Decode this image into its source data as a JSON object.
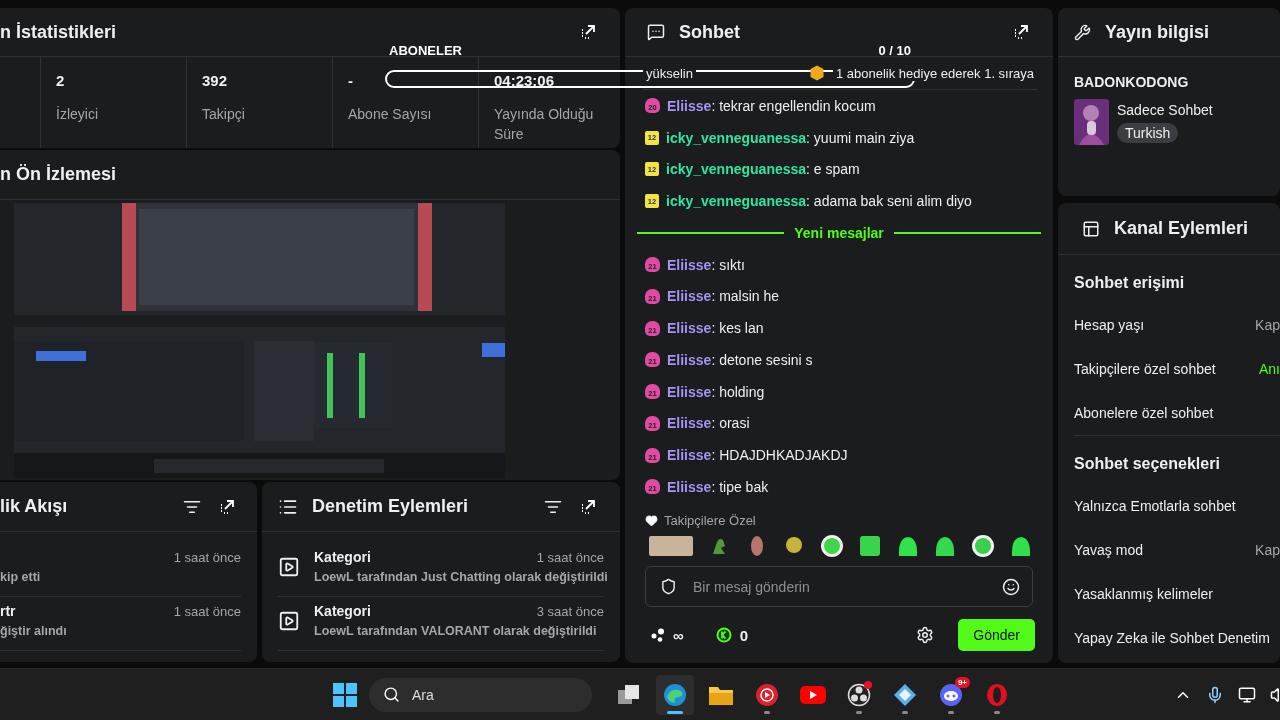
{
  "overlay": {
    "title": "ABONELER",
    "count": "0 / 10",
    "level": 0
  },
  "stats_panel": {
    "title": "n İstatistikleri",
    "stats": [
      {
        "value": "2",
        "label": "İzleyici"
      },
      {
        "value": "392",
        "label": "Takipçi"
      },
      {
        "value": "-",
        "label": "Abone Sayısı"
      },
      {
        "value": "04:23:06",
        "label": "Yayında Olduğu Süre"
      }
    ]
  },
  "preview_panel": {
    "title": "n Ön İzlemesi"
  },
  "activity_panel": {
    "title": "lik Akışı",
    "items": [
      {
        "time": "1 saat önce",
        "text": "kip etti"
      },
      {
        "title": "rtr",
        "time": "1 saat önce",
        "text": "**ğiştir** alındı"
      }
    ]
  },
  "moderation_panel": {
    "title": "Denetim Eylemleri",
    "items": [
      {
        "title": "Kategori",
        "time": "1 saat önce",
        "text": "**LoewL** tarafından **Just Chatting** olarak değiştirildi"
      },
      {
        "title": "Kategori",
        "time": "3 saat önce",
        "text": "**LoewL** tarafından **VALORANT** olarak değiştirildi"
      }
    ]
  },
  "chat": {
    "title": "Sohbet",
    "pinned": {
      "left": "yükselin",
      "text": "1 abonelik hediye ederek 1. sıraya"
    },
    "messages": [
      {
        "kind": "message",
        "badge": {
          "kind": "sub",
          "text": "20"
        },
        "user": "Eliisse",
        "color": "#a792f5",
        "text": ": tekrar engellendin kocum"
      },
      {
        "kind": "message",
        "badge": {
          "kind": "gift",
          "text": "12"
        },
        "user": "icky_venneguanessa",
        "color": "#33e6a0",
        "text": ": yuumi main ziya"
      },
      {
        "kind": "message",
        "badge": {
          "kind": "gift",
          "text": "12"
        },
        "user": "icky_venneguanessa",
        "color": "#33e6a0",
        "text": ": e spam"
      },
      {
        "kind": "message",
        "badge": {
          "kind": "gift",
          "text": "12"
        },
        "user": "icky_venneguanessa",
        "color": "#33e6a0",
        "text": ": adama bak seni alim diyo"
      },
      {
        "kind": "divider",
        "text": "Yeni mesajlar"
      },
      {
        "kind": "message",
        "badge": {
          "kind": "sub",
          "text": "21"
        },
        "user": "Eliisse",
        "color": "#a792f5",
        "text": ": sıktı"
      },
      {
        "kind": "message",
        "badge": {
          "kind": "sub",
          "text": "21"
        },
        "user": "Eliisse",
        "color": "#a792f5",
        "text": ": malsin he"
      },
      {
        "kind": "message",
        "badge": {
          "kind": "sub",
          "text": "21"
        },
        "user": "Eliisse",
        "color": "#a792f5",
        "text": ": kes lan"
      },
      {
        "kind": "message",
        "badge": {
          "kind": "sub",
          "text": "21"
        },
        "user": "Eliisse",
        "color": "#a792f5",
        "text": ": detone sesini s"
      },
      {
        "kind": "message",
        "badge": {
          "kind": "sub",
          "text": "21"
        },
        "user": "Eliisse",
        "color": "#a792f5",
        "text": ": holding"
      },
      {
        "kind": "message",
        "badge": {
          "kind": "sub",
          "text": "21"
        },
        "user": "Eliisse",
        "color": "#a792f5",
        "text": ": orasi"
      },
      {
        "kind": "message",
        "badge": {
          "kind": "sub",
          "text": "21"
        },
        "user": "Eliisse",
        "color": "#a792f5",
        "text": ": HDAJDHKADJAKDJ"
      },
      {
        "kind": "message",
        "badge": {
          "kind": "sub",
          "text": "21"
        },
        "user": "Eliisse",
        "color": "#a792f5",
        "text": ": tipe bak"
      }
    ],
    "emote_section": "Takipçilere Özel",
    "input": {
      "placeholder": "Bir mesaj gönderin"
    },
    "points": "∞",
    "coins": "0",
    "send": "Gönder"
  },
  "stream_info": {
    "title": "Yayın bilgisi",
    "stream_title": "BADONKODONG",
    "category": "Sadece Sohbet",
    "tag": "Turkish"
  },
  "channel_actions": {
    "title": "Kanal Eylemleri",
    "sections": [
      {
        "title": "Sohbet erişimi",
        "items": [
          {
            "label": "Hesap yaşı",
            "value": "Kap",
            "on": false
          },
          {
            "label": "Takipçilere özel sohbet",
            "value": "Anı",
            "on": true
          },
          {
            "label": "Abonelere özel sohbet"
          }
        ]
      },
      {
        "title": "Sohbet seçenekleri",
        "items": [
          {
            "label": "Yalnızca Emotlarla sohbet"
          },
          {
            "label": "Yavaş mod",
            "value": "Kap",
            "on": false
          },
          {
            "label": "Yasaklanmış kelimeler"
          },
          {
            "label": "Yapay Zeka ile Sohbet Denetim"
          }
        ]
      }
    ]
  },
  "taskbar": {
    "search": {
      "placeholder": "Ara"
    },
    "apps": [
      {
        "kind": "taskview",
        "running": false,
        "selected": false
      },
      {
        "kind": "edge",
        "running": true,
        "selected": true
      },
      {
        "kind": "files",
        "running": false,
        "selected": false
      },
      {
        "kind": "music",
        "running": true,
        "selected": false
      },
      {
        "kind": "youtube",
        "running": false,
        "selected": false
      },
      {
        "kind": "obs",
        "running": true,
        "selected": false,
        "dot": true
      },
      {
        "kind": "diamond",
        "running": true,
        "selected": false
      },
      {
        "kind": "discord",
        "running": true,
        "selected": false,
        "badge": "9+"
      },
      {
        "kind": "opera",
        "running": true,
        "selected": false
      }
    ]
  }
}
